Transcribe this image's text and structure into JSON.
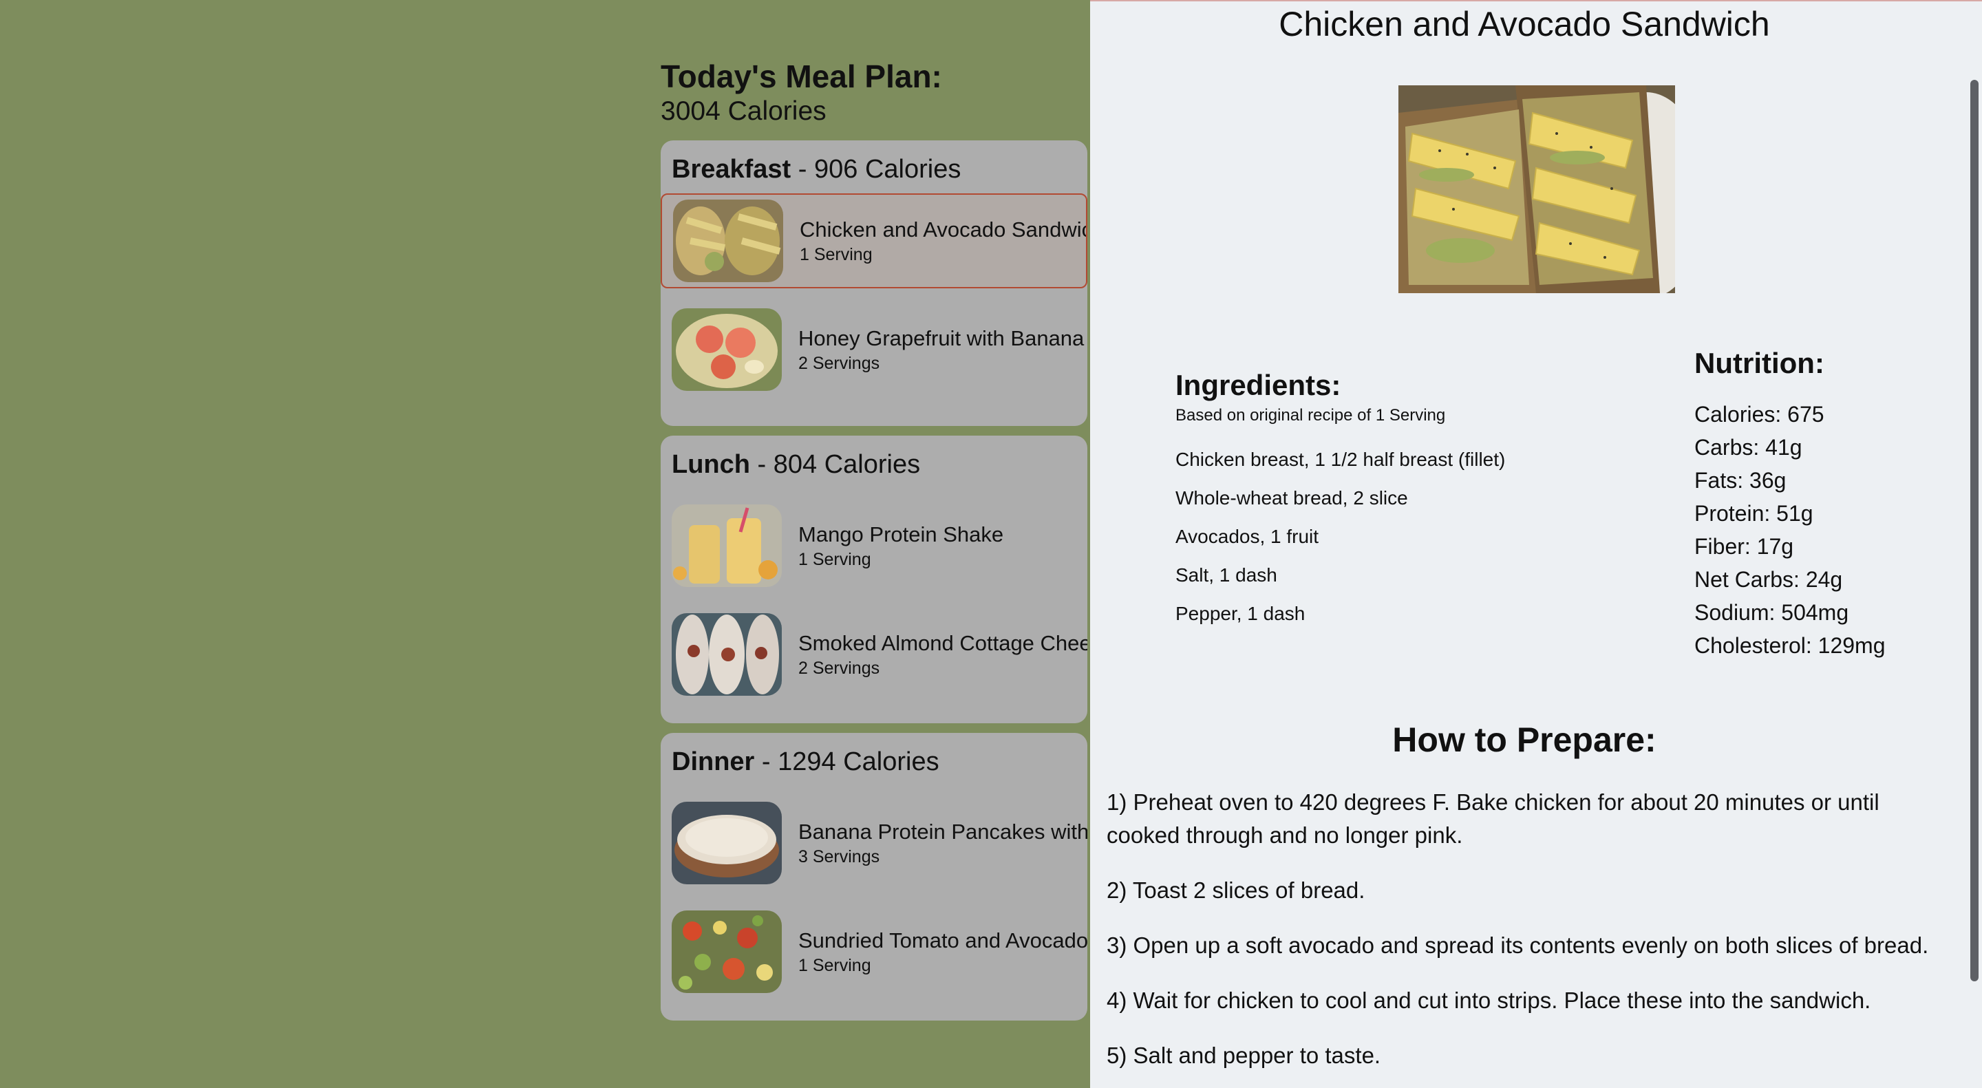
{
  "plan": {
    "title": "Today's Meal Plan:",
    "calories": "3004 Calories",
    "meals": [
      {
        "name": "Breakfast",
        "calories": "- 906 Calories",
        "items": [
          {
            "name": "Chicken and Avocado Sandwich",
            "servings": "1 Serving"
          },
          {
            "name": "Honey Grapefruit with Banana",
            "servings": "2 Servings"
          }
        ]
      },
      {
        "name": "Lunch",
        "calories": "- 804 Calories",
        "items": [
          {
            "name": "Mango Protein Shake",
            "servings": "1 Serving"
          },
          {
            "name": "Smoked Almond Cottage Cheese",
            "servings": "2 Servings"
          }
        ]
      },
      {
        "name": "Dinner",
        "calories": "- 1294 Calories",
        "items": [
          {
            "name": "Banana Protein Pancakes with",
            "servings": "3 Servings"
          },
          {
            "name": "Sundried Tomato and Avocado",
            "servings": "1 Serving"
          }
        ]
      }
    ]
  },
  "recipe": {
    "title": "Chicken and Avocado Sandwich",
    "ingredients_title": "Ingredients:",
    "ingredients_basis": "Based on original recipe of 1 Serving",
    "ingredients": [
      "Chicken breast, 1 1/2 half breast (fillet)",
      "Whole-wheat bread, 2 slice",
      "Avocados, 1 fruit",
      "Salt, 1 dash",
      "Pepper, 1 dash"
    ],
    "nutrition_title": "Nutrition:",
    "nutrition": [
      "Calories: 675",
      "Carbs: 41g",
      "Fats: 36g",
      "Protein: 51g",
      "Fiber: 17g",
      "Net Carbs: 24g",
      "Sodium: 504mg",
      "Cholesterol: 129mg"
    ],
    "prepare_title": "How to Prepare:",
    "steps": [
      "1) Preheat oven to 420 degrees F. Bake chicken for about 20 minutes or until cooked through and no longer pink.",
      "2) Toast 2 slices of bread.",
      "3) Open up a soft avocado and spread its contents evenly on both slices of bread.",
      "4) Wait for chicken to cool and cut into strips. Place these into the sandwich.",
      "5) Salt and pepper to taste."
    ]
  },
  "colors": {
    "backdrop": "#7e8d5d",
    "card": "#adadad",
    "panel": "#edf0f3",
    "selected_border": "#b24a32"
  }
}
